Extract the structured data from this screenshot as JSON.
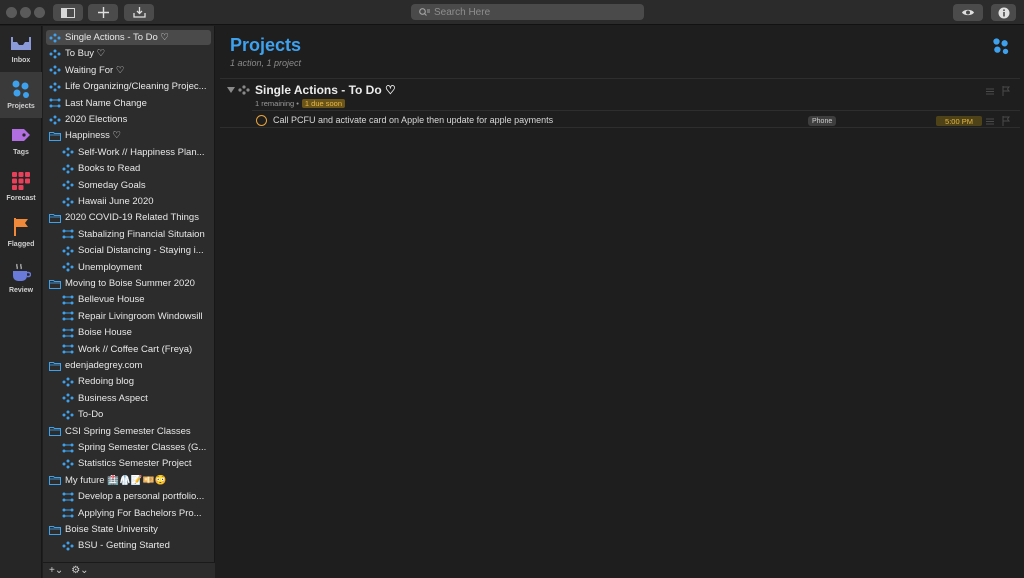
{
  "toolbar": {
    "search_placeholder": "Search Here"
  },
  "perspectives": [
    {
      "label": "Inbox",
      "icon": "inbox-icon"
    },
    {
      "label": "Projects",
      "icon": "projects-icon"
    },
    {
      "label": "Tags",
      "icon": "tag-icon"
    },
    {
      "label": "Forecast",
      "icon": "forecast-icon"
    },
    {
      "label": "Flagged",
      "icon": "flag-icon"
    },
    {
      "label": "Review",
      "icon": "review-icon"
    }
  ],
  "sidebar": {
    "items": [
      {
        "label": "Single Actions - To Do ♡",
        "type": "project",
        "indent": 0
      },
      {
        "label": "To Buy ♡",
        "type": "project",
        "indent": 0
      },
      {
        "label": "Waiting For ♡",
        "type": "project",
        "indent": 0
      },
      {
        "label": "Life Organizing/Cleaning Projec...",
        "type": "project",
        "indent": 0
      },
      {
        "label": "Last Name Change",
        "type": "sequential",
        "indent": 0
      },
      {
        "label": "2020 Elections",
        "type": "project",
        "indent": 0
      },
      {
        "label": "Happiness ♡",
        "type": "folder",
        "indent": 0
      },
      {
        "label": "Self-Work // Happiness Plan...",
        "type": "project",
        "indent": 1
      },
      {
        "label": "Books to Read",
        "type": "project",
        "indent": 1
      },
      {
        "label": "Someday Goals",
        "type": "project",
        "indent": 1
      },
      {
        "label": "Hawaii June 2020",
        "type": "project",
        "indent": 1
      },
      {
        "label": "2020 COVID-19 Related Things",
        "type": "folder",
        "indent": 0
      },
      {
        "label": "Stabalizing Financial Situtaion",
        "type": "sequential",
        "indent": 1
      },
      {
        "label": "Social Distancing - Staying i...",
        "type": "project",
        "indent": 1
      },
      {
        "label": "Unemployment",
        "type": "project",
        "indent": 1
      },
      {
        "label": "Moving to Boise Summer 2020",
        "type": "folder",
        "indent": 0
      },
      {
        "label": "Bellevue House",
        "type": "sequential",
        "indent": 1
      },
      {
        "label": "Repair Livingroom Windowsill",
        "type": "sequential",
        "indent": 1
      },
      {
        "label": "Boise House",
        "type": "sequential",
        "indent": 1
      },
      {
        "label": "Work // Coffee Cart (Freya)",
        "type": "sequential",
        "indent": 1
      },
      {
        "label": "edenjadegrey.com",
        "type": "folder",
        "indent": 0
      },
      {
        "label": "Redoing blog",
        "type": "project",
        "indent": 1
      },
      {
        "label": "Business Aspect",
        "type": "project",
        "indent": 1
      },
      {
        "label": "To-Do",
        "type": "project",
        "indent": 1
      },
      {
        "label": "CSI Spring Semester Classes",
        "type": "folder",
        "indent": 0
      },
      {
        "label": "Spring Semester Classes (G...",
        "type": "sequential",
        "indent": 1
      },
      {
        "label": "Statistics Semester Project",
        "type": "project",
        "indent": 1
      },
      {
        "label": "My future 🏥🥼📝💴😳",
        "type": "folder",
        "indent": 0
      },
      {
        "label": "Develop a personal portfolio...",
        "type": "sequential",
        "indent": 1
      },
      {
        "label": "Applying For Bachelors Pro...",
        "type": "sequential",
        "indent": 1
      },
      {
        "label": "Boise State University",
        "type": "folder",
        "indent": 0
      },
      {
        "label": "BSU - Getting Started",
        "type": "project",
        "indent": 1
      }
    ],
    "add_label": "+⌄",
    "settings_label": "⚙⌄"
  },
  "main": {
    "title": "Projects",
    "subtitle": "1 action, 1 project",
    "project": {
      "name": "Single Actions - To Do ♡",
      "remaining": "1 remaining •",
      "due_badge": "1 due soon"
    },
    "task": {
      "text": "Call PCFU and activate card on Apple then update for apple payments",
      "tag": "Phone",
      "due": "5:00 PM"
    }
  },
  "colors": {
    "accent": "#3ea1ee",
    "due": "#e6b740",
    "check": "#e8a33a",
    "forecast": "#e8405a",
    "tags": "#b06ee0",
    "flag": "#f08a3a"
  }
}
